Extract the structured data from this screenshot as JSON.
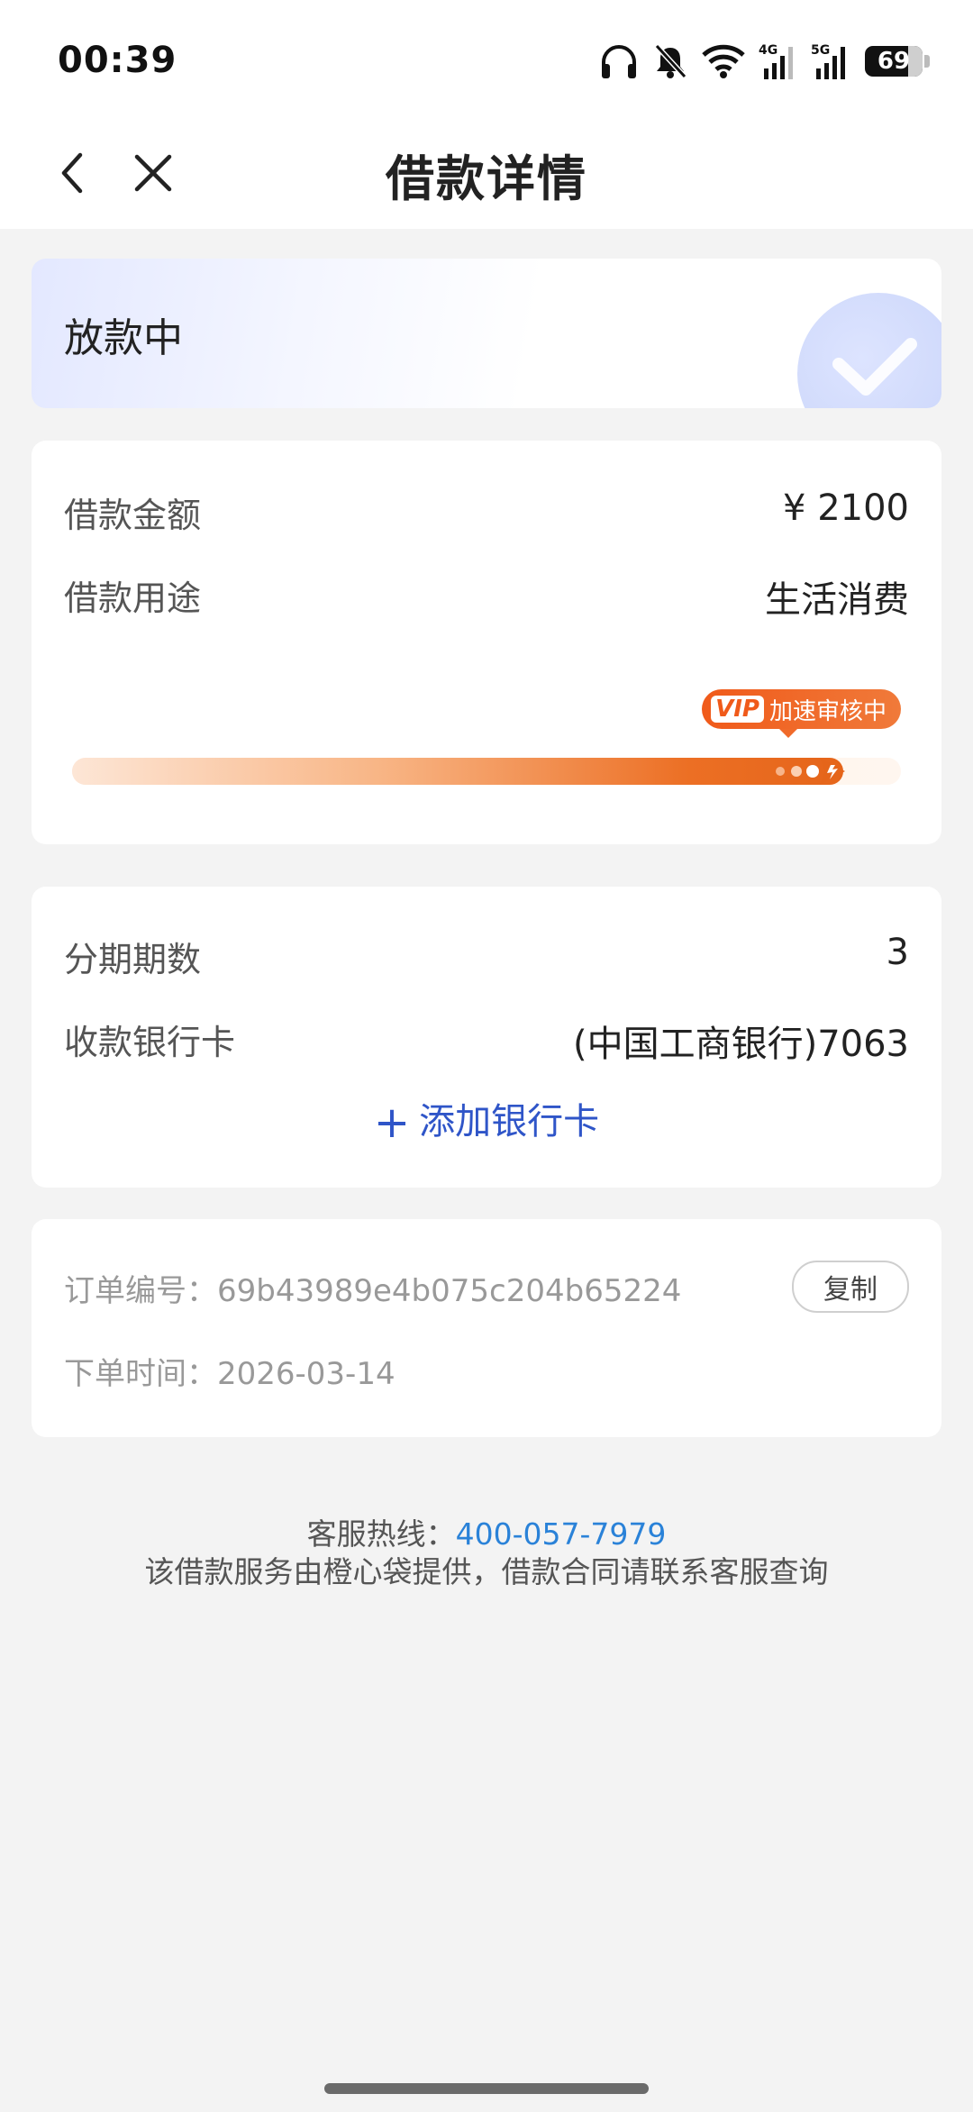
{
  "status_bar": {
    "time": "00:39",
    "battery_level": "69",
    "icons": [
      "headphones-icon",
      "bell-muted-icon",
      "wifi-icon",
      "signal-4g-icon",
      "signal-5g-icon",
      "battery-icon"
    ]
  },
  "nav": {
    "title": "借款详情",
    "back_icon": "chevron-left-icon",
    "close_icon": "close-icon"
  },
  "status_card": {
    "status": "放款中",
    "icon": "check-circle-icon"
  },
  "loan": {
    "amount_label": "借款金额",
    "amount_value": "¥ 2100",
    "purpose_label": "借款用途",
    "purpose_value": "生活消费",
    "badge_vip": "VIP",
    "badge_text": "加速审核中",
    "progress_fraction": 0.93
  },
  "bank": {
    "installments_label": "分期期数",
    "installments_value": "3",
    "card_label": "收款银行卡",
    "card_value": "(中国工商银行)7063",
    "add_bank_label": "添加银行卡"
  },
  "order": {
    "order_no_label": "订单编号：",
    "order_no_value": "69b43989e4b075c204b65224",
    "copy_label": "复制",
    "order_time_label": "下单时间：",
    "order_time_value": "2026-03-14"
  },
  "footer": {
    "hotline_label": "客服热线：",
    "hotline_number": "400-057-7979",
    "notice": "该借款服务由橙心袋提供，借款合同请联系客服查询"
  },
  "colors": {
    "accent_blue": "#2f55c8",
    "link_blue": "#2a82d8",
    "progress_orange": "#ec6f24",
    "page_bg": "#f3f3f3"
  }
}
